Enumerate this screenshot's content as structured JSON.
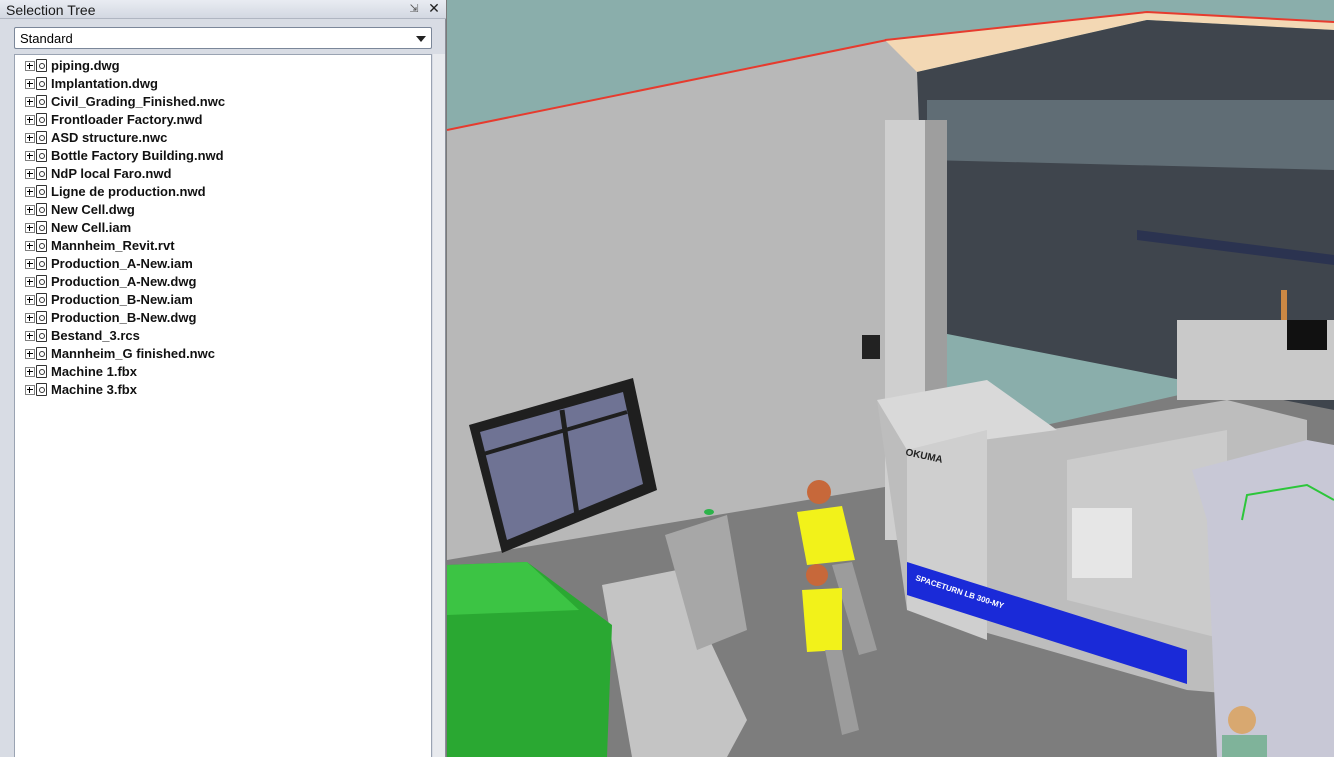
{
  "panel": {
    "title": "Selection Tree",
    "mode_value": "Standard"
  },
  "tree": {
    "items": [
      {
        "label": "piping.dwg"
      },
      {
        "label": "Implantation.dwg"
      },
      {
        "label": "Civil_Grading_Finished.nwc"
      },
      {
        "label": "Frontloader Factory.nwd"
      },
      {
        "label": "ASD structure.nwc"
      },
      {
        "label": "Bottle Factory Building.nwd"
      },
      {
        "label": "NdP local Faro.nwd"
      },
      {
        "label": "Ligne de production.nwd"
      },
      {
        "label": "New Cell.dwg"
      },
      {
        "label": "New Cell.iam"
      },
      {
        "label": "Mannheim_Revit.rvt"
      },
      {
        "label": "Production_A-New.iam"
      },
      {
        "label": "Production_A-New.dwg"
      },
      {
        "label": "Production_B-New.iam"
      },
      {
        "label": "Production_B-New.dwg"
      },
      {
        "label": "Bestand_3.rcs"
      },
      {
        "label": "Mannheim_G finished.nwc"
      },
      {
        "label": "Machine 1.fbx"
      },
      {
        "label": "Machine 3.fbx"
      }
    ]
  },
  "scene": {
    "machine_brand": "OKUMA",
    "machine_model": "SPACETURN LB 300-MY"
  },
  "colors": {
    "sky": "#8aaeab",
    "wall": "#b8b8b8",
    "floor": "#7d7d7d",
    "machine_band": "#1a2ad8",
    "crate": "#2aa832",
    "worker_shirt": "#f2f21a"
  }
}
